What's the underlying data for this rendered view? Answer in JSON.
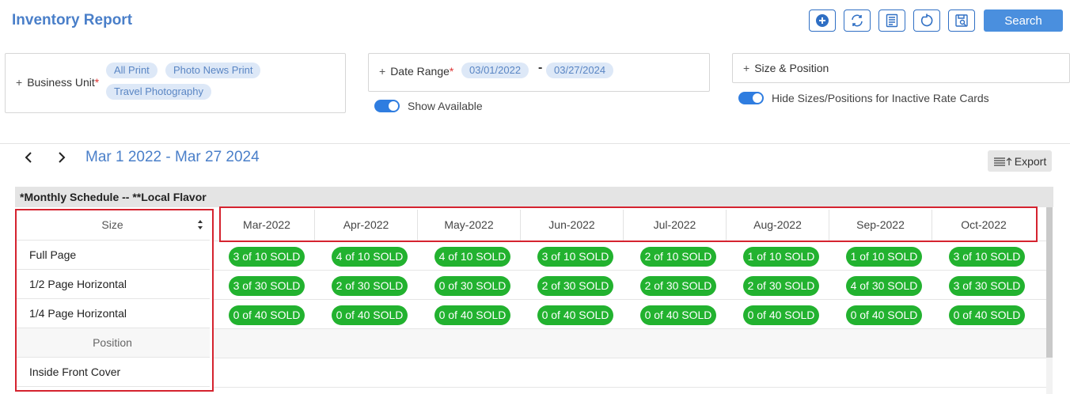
{
  "header": {
    "title": "Inventory Report",
    "search_label": "Search",
    "toolbar_icons": [
      "add-icon",
      "refresh-icon",
      "list-icon",
      "reset-icon",
      "save-view-icon"
    ]
  },
  "filters": {
    "business_unit": {
      "label": "Business Unit",
      "required_mark": "*",
      "chips": [
        "All Print",
        "Photo News Print",
        "Travel Photography"
      ]
    },
    "date_range": {
      "label": "Date Range",
      "required_mark": "*",
      "start": "03/01/2022",
      "separator": "-",
      "end": "03/27/2024"
    },
    "size_position": {
      "label": "Size & Position"
    },
    "show_available": {
      "label": "Show Available",
      "on": true
    },
    "hide_inactive": {
      "label": "Hide Sizes/Positions for Inactive Rate Cards",
      "on": true
    }
  },
  "range": {
    "title": "Mar 1 2022 - Mar 27 2024",
    "export_label": "Export"
  },
  "schedule": {
    "title": "*Monthly Schedule -- **Local Flavor",
    "size_header": "Size",
    "position_header": "Position",
    "months": [
      "Mar-2022",
      "Apr-2022",
      "May-2022",
      "Jun-2022",
      "Jul-2022",
      "Aug-2022",
      "Sep-2022",
      "Oct-2022"
    ],
    "rows": [
      {
        "size": "Full Page",
        "cells": [
          "3 of 10 SOLD",
          "4 of 10 SOLD",
          "4 of 10 SOLD",
          "3 of 10 SOLD",
          "2 of 10 SOLD",
          "1 of 10 SOLD",
          "1 of 10 SOLD",
          "3 of 10 SOLD"
        ]
      },
      {
        "size": "1/2 Page Horizontal",
        "cells": [
          "3 of 30 SOLD",
          "2 of 30 SOLD",
          "0 of 30 SOLD",
          "2 of 30 SOLD",
          "2 of 30 SOLD",
          "2 of 30 SOLD",
          "4 of 30 SOLD",
          "3 of 30 SOLD"
        ]
      },
      {
        "size": "1/4 Page Horizontal",
        "cells": [
          "0 of 40 SOLD",
          "0 of 40 SOLD",
          "0 of 40 SOLD",
          "0 of 40 SOLD",
          "0 of 40 SOLD",
          "0 of 40 SOLD",
          "0 of 40 SOLD",
          "0 of 40 SOLD"
        ]
      }
    ],
    "positions": [
      "Inside Front Cover"
    ]
  },
  "colors": {
    "accent": "#4a7fc9",
    "sold_pill": "#22b22f",
    "highlight": "#d5232f",
    "chip_bg": "#dde8f7"
  }
}
